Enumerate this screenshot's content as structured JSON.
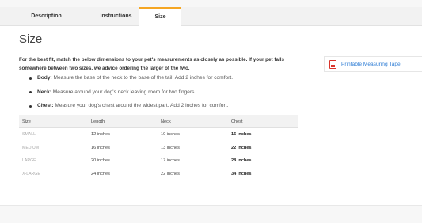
{
  "tabs": [
    {
      "label": "Description"
    },
    {
      "label": "Instructions"
    },
    {
      "label": "Size"
    }
  ],
  "page_title": "Size",
  "intro": "For the best fit, match the below dimensions to your pet's measurements as closely as possible. If your pet falls somewhere between two sizes, we advice ordering the larger of the two.",
  "tips": [
    {
      "term": "Body:",
      "text": " Measure the base of the neck to the base of the tail. Add 2 inches for comfort."
    },
    {
      "term": "Neck:",
      "text": " Measure around your dog's neck leaving room for two fingers."
    },
    {
      "term": "Chest:",
      "text": " Measure your dog's chest around the widest part. Add 2 inches for comfort."
    }
  ],
  "table": {
    "headers": [
      "Size",
      "Length",
      "Neck",
      "Chest"
    ],
    "rows": [
      [
        "SMALL",
        "12 inches",
        "10 inches",
        "16 inches"
      ],
      [
        "MEDIUM",
        "16 inches",
        "13 inches",
        "22 inches"
      ],
      [
        "LARGE",
        "20 inches",
        "17 inches",
        "28 inches"
      ],
      [
        "X-LARGE",
        "24 inches",
        "22 inches",
        "34 inches"
      ]
    ]
  },
  "sidebar": {
    "link_label": "Printable Measuring Tape",
    "icon": "pdf-icon"
  },
  "colors": {
    "accent_tab": "#f5a623",
    "link": "#2b7bd4",
    "pdf_red": "#d9342b"
  }
}
